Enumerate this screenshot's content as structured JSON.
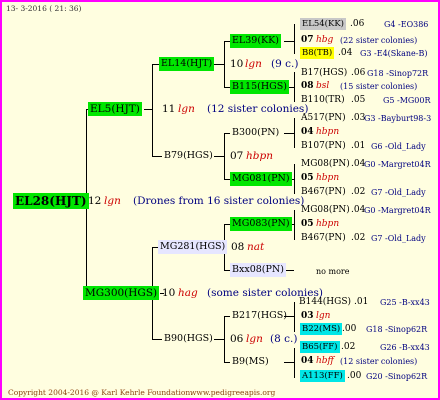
{
  "header": {
    "date": "13- 3-2016 ( 21: 36)"
  },
  "footer": {
    "copyright": "Copyright 2004-2016 @ Karl Kehrle Foundation.",
    "site": "www.pedigreeapis.org"
  },
  "root": {
    "label": "EL28(HJT)",
    "num": "12",
    "sym": "lgn",
    "note": "(Drones from 16 sister colonies)"
  },
  "el5": {
    "label": "EL5(HJT)",
    "num": "11",
    "sym": "lgn",
    "note": "(12 sister colonies)"
  },
  "mg300": {
    "label": "MG300(HGS)",
    "num": "10",
    "sym": "hag",
    "note": "(some sister colonies)"
  },
  "el14": {
    "label": "EL14(HJT)"
  },
  "b79": {
    "label": "B79(HGS)",
    "num": "07",
    "sym": "hbpn"
  },
  "mg281": {
    "label": "MG281(HGS)",
    "num": "08",
    "sym": "nat"
  },
  "b90": {
    "label": "B90(HGS)",
    "num": "10",
    "sym": "hag"
  },
  "el39": {
    "label": "EL39(KK)",
    "num": "10",
    "sym": "lgn",
    "note": "(9 c.)"
  },
  "b115": {
    "label": "B115(HGS)"
  },
  "b300": {
    "label": "B300(PN)",
    "num": "04",
    "sym": "hbpn"
  },
  "mg081": {
    "label": "MG081(PN)"
  },
  "mg083": {
    "label": "MG083(PN)"
  },
  "bxx08": {
    "label": "Bxx08(PN)",
    "note": "no more"
  },
  "b217": {
    "label": "B217(HGS)",
    "num": "06",
    "sym": "lgn",
    "note": "(8 c.)"
  },
  "b9": {
    "label": "B9(MS)"
  },
  "el54": {
    "label": "EL54(KK)",
    "year": ".06",
    "ref": "G4 -EO386"
  },
  "g1": {
    "num": "07",
    "sym": "hbg",
    "note": "(22 sister colonies)"
  },
  "b8": {
    "label": "B8(TB)",
    "year": ".04",
    "ref": "G3 -E4(Skane-B)"
  },
  "b17": {
    "label": "B17(HGS)",
    "year": ".06",
    "ref": "G18 -Sinop72R"
  },
  "g2": {
    "num": "08",
    "sym": "bsl",
    "note": "(15 sister colonies)"
  },
  "b110": {
    "label": "B110(TR)",
    "year": ".05",
    "ref": "G5 -MG00R"
  },
  "a517": {
    "label": "A517(PN)",
    "year": ".03",
    "ref": "G3 -Bayburt98-3"
  },
  "g3": {
    "num": "04",
    "sym": "hbpn"
  },
  "b107": {
    "label": "B107(PN)",
    "year": ".01",
    "ref": "G6 -Old_Lady"
  },
  "mg08": {
    "label": "MG08(PN)",
    "year": ".04",
    "ref": "G0 -Margret04R"
  },
  "g4": {
    "num": "05",
    "sym": "hbpn"
  },
  "b467a": {
    "label": "B467(PN)",
    "year": ".02",
    "ref": "G7 -Old_Lady"
  },
  "mg08b": {
    "label": "MG08(PN)",
    "year": ".04",
    "ref": "G0 -Margret04R"
  },
  "g5": {
    "num": "05",
    "sym": "hbpn"
  },
  "b467b": {
    "label": "B467(PN)",
    "year": ".02",
    "ref": "G7 -Old_Lady"
  },
  "b144": {
    "label": "B144(HGS)",
    "year": ".01",
    "ref": "G25 -B-xx43"
  },
  "g6": {
    "num": "03",
    "sym": "lgn"
  },
  "b22": {
    "label": "B22(MS)",
    "year": ".00",
    "ref": "G18 -Sinop62R"
  },
  "b65": {
    "label": "B65(FF)",
    "year": ".02",
    "ref": "G26 -B-xx43"
  },
  "g7": {
    "num": "04",
    "sym": "hbff",
    "note": "(12 sister colonies)"
  },
  "a113": {
    "label": "A113(FF)",
    "year": ".00",
    "ref": "G20 -Sinop62R"
  }
}
